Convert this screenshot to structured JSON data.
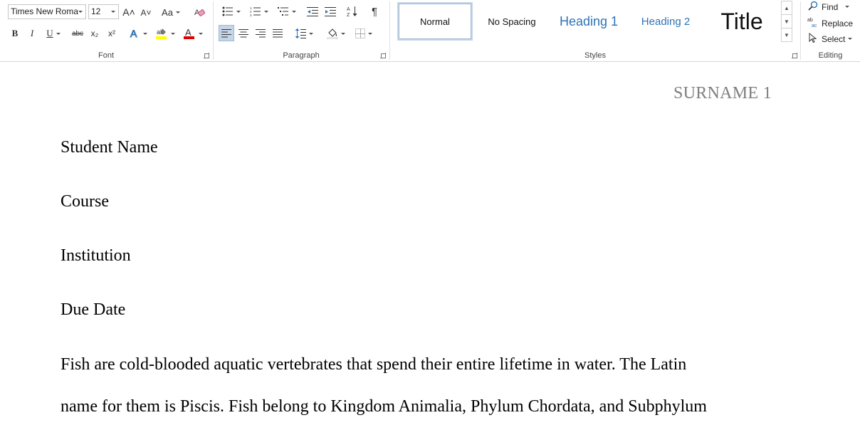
{
  "ribbon": {
    "font": {
      "label": "Font",
      "font_name": "Times New Roma",
      "font_size": "12",
      "grow_icon": "A˄",
      "shrink_icon": "A˅",
      "case_label": "Aa",
      "bold": "B",
      "italic": "I",
      "underline": "U",
      "strike": "abc",
      "subscript": "x₂",
      "superscript": "x²",
      "highlight_color": "#ffff00",
      "font_color": "#e00000"
    },
    "paragraph": {
      "label": "Paragraph",
      "pilcrow": "¶"
    },
    "styles": {
      "label": "Styles",
      "items": [
        {
          "label": "Normal"
        },
        {
          "label": "No Spacing"
        },
        {
          "label": "Heading 1"
        },
        {
          "label": "Heading 2"
        },
        {
          "label": "Title"
        }
      ],
      "heading_color": "#2e74b5"
    },
    "editing": {
      "label": "Editing",
      "find": "Find",
      "replace": "Replace",
      "select": "Select"
    }
  },
  "document": {
    "header": "SURNAME 1",
    "lines": [
      "Student Name",
      "Course",
      "Institution",
      "Due Date",
      "Fish are cold-blooded aquatic vertebrates that spend their entire lifetime in water. The Latin",
      "name for them is Piscis. Fish belong to Kingdom Animalia, Phylum Chordata, and Subphylum"
    ]
  }
}
